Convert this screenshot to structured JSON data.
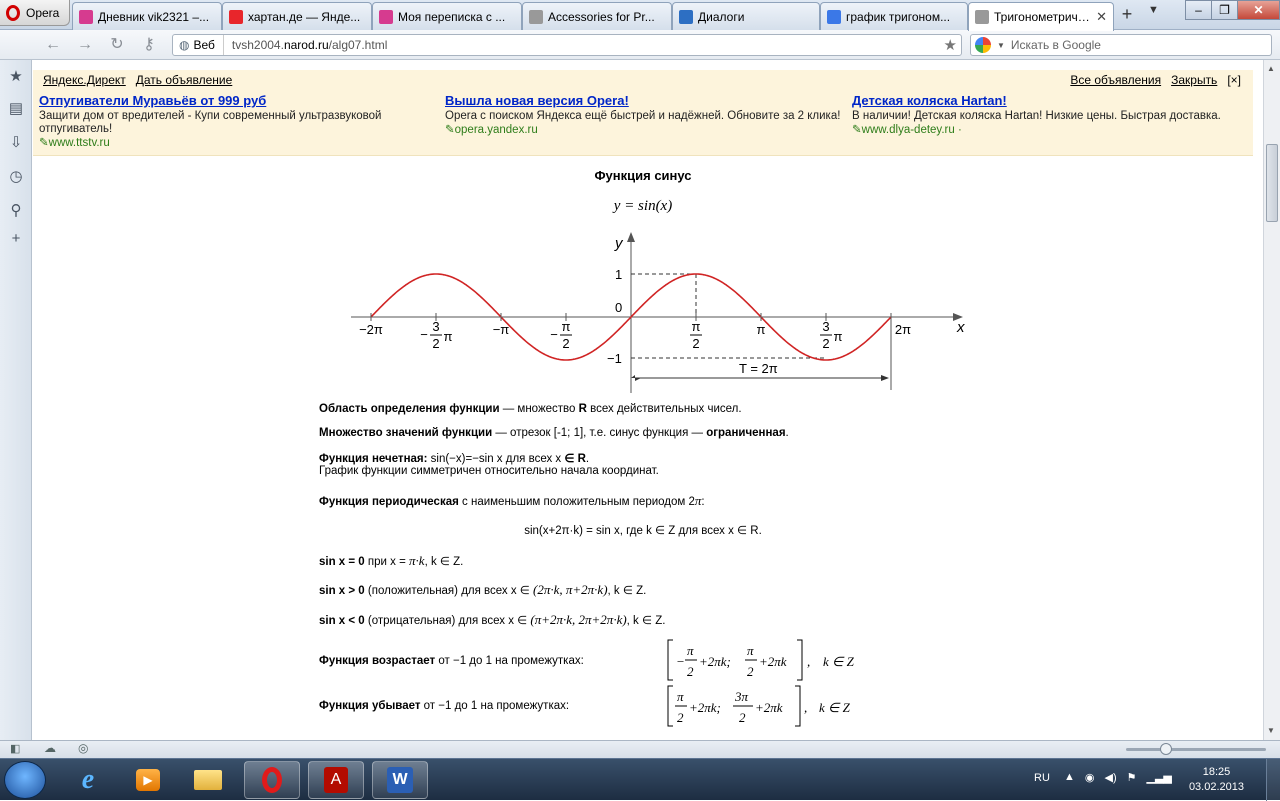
{
  "browser": {
    "menu_label": "Opera",
    "tabs": [
      {
        "title": "Дневник vik2321 –...",
        "icon": "diary-icon",
        "color": "#d63b8f"
      },
      {
        "title": "хартан.де — Янде...",
        "icon": "yandex-icon",
        "color": "#e8262b"
      },
      {
        "title": "Моя переписка с ...",
        "icon": "diary-icon",
        "color": "#d63b8f"
      },
      {
        "title": "Accessories for Pr...",
        "icon": "page-icon",
        "color": "#999999"
      },
      {
        "title": "Диалоги",
        "icon": "dialog-icon",
        "color": "#2d6fc3"
      },
      {
        "title": "график тригоном...",
        "icon": "google-icon",
        "color": "#3b78e7"
      },
      {
        "title": "Тригонометриче...",
        "icon": "page-icon",
        "color": "#999999",
        "active": true
      }
    ],
    "address": {
      "scope_label": "Веб",
      "url_prefix": "tvsh2004.",
      "url_domain": "narod.ru",
      "url_path": "/alg07.html"
    },
    "search_placeholder": "Искать в Google"
  },
  "ads": {
    "label": "Яндекс.Директ",
    "add_label": "Дать объявление",
    "all_label": "Все объявления",
    "close_label": "Закрыть",
    "close_x": "[×]",
    "items": [
      {
        "title": "Отпугиватели Муравьёв от 999 руб",
        "text": "Защити дом от вредителей - Купи современный ультразвуковой отпугиватель!",
        "url": "www.ttstv.ru"
      },
      {
        "title": "Вышла новая версия Opera!",
        "text": "Opera с поиском Яндекса ещё быстрей и надёжней. Обновите за 2 клика!",
        "url": "opera.yandex.ru"
      },
      {
        "title": "Детская коляска Hartan!",
        "text": "В наличии! Детская коляска Hartan! Низкие цены. Быстрая доставка.",
        "url": "www.dlya-detey.ru",
        "url_suffix": "·"
      }
    ]
  },
  "article": {
    "title": "Функция синус",
    "formula": "y = sin(x)",
    "graph": {
      "axis_x": "x",
      "axis_y": "y",
      "origin": "0",
      "y_one": "1",
      "y_minus_one": "−1",
      "period_label": "T = 2π",
      "x_ticks": [
        {
          "top": "−2π"
        },
        {
          "sign": "−",
          "num": "3",
          "den": "2",
          "tail": "π"
        },
        {
          "top": "−π"
        },
        {
          "sign": "−",
          "num": "π",
          "den": "2"
        },
        {
          "num": "π",
          "den": "2"
        },
        {
          "top": "π"
        },
        {
          "num": "3",
          "den": "2",
          "tail": "π"
        },
        {
          "top": "2π"
        }
      ]
    },
    "p1_bold": "Область определения функции",
    "p1_rest": " — множество ",
    "p1_R": "R",
    "p1_tail": " всех действительных чисел.",
    "p2_bold": "Множество значений функции",
    "p2_rest": " — отрезок [-1; 1], т.е. синус функция — ",
    "p2_bold2": "ограниченная",
    "p2_tail": ".",
    "p3_bold": "Функция нечетная:",
    "p3_rest": " sin(−x)=−sin x для всех x ",
    "p3_in": "∈",
    "p3_R": " R",
    "p3_tail": ".",
    "p3_line2": "График функции симметричен относительно начала координат.",
    "p4_bold": "Функция периодическая",
    "p4_rest": " с наименьшим положительным периодом 2",
    "p4_pi": "π",
    "p4_tail": ":",
    "p5": "sin(x+2π·k) = sin x, где k ∈ Z для всех x ∈ R.",
    "p6_bold": "sin x = 0",
    "p6_rest": " при x = ",
    "p6_math": "π·k",
    "p6_tail": ", k ∈ Z.",
    "p7_bold": "sin x > 0",
    "p7_rest": " (положительная) для всех x ∈ ",
    "p7_math": "(2π·k, π+2π·k)",
    "p7_tail": ", k ∈ Z.",
    "p8_bold": "sin x < 0",
    "p8_rest": " (отрицательная) для всех x ∈ ",
    "p8_math": "(π+2π·k, 2π+2π·k)",
    "p8_tail": ", k ∈ Z.",
    "inc_bold": "Функция возрастает",
    "inc_rest": " от −1 до 1 на промежутках:",
    "inc_formula": {
      "a_sign": "−",
      "a_num": "π",
      "a_den": "2",
      "a_tail": "+2πk;",
      "b_num": "π",
      "b_den": "2",
      "b_tail": "+2πk",
      "k": "k ∈ Z"
    },
    "dec_bold": "Функция убывает",
    "dec_rest": " от −1 до 1 на промежутках:",
    "dec_formula": {
      "a_num": "π",
      "a_den": "2",
      "a_tail": "+2πk;",
      "b_num": "3π",
      "b_den": "2",
      "b_tail": "+2πk",
      "k": "k ∈ Z"
    }
  },
  "taskbar": {
    "lang": "RU",
    "time": "18:25",
    "date": "03.02.2013"
  }
}
